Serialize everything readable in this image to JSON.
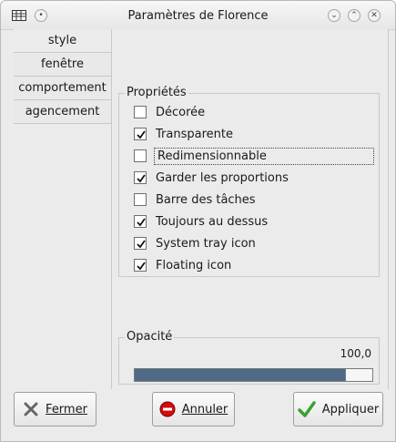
{
  "window": {
    "title": "Paramètres de Florence"
  },
  "tabs": [
    {
      "label": "style"
    },
    {
      "label": "fenêtre"
    },
    {
      "label": "comportement"
    },
    {
      "label": "agencement"
    }
  ],
  "properties": {
    "title": "Propriétés",
    "options": [
      {
        "label": "Décorée",
        "checked": false
      },
      {
        "label": "Transparente",
        "checked": true
      },
      {
        "label": "Redimensionnable",
        "checked": false
      },
      {
        "label": "Garder les proportions",
        "checked": true
      },
      {
        "label": "Barre des tâches",
        "checked": false
      },
      {
        "label": "Toujours au dessus",
        "checked": true
      },
      {
        "label": "System tray icon",
        "checked": true
      },
      {
        "label": "Floating icon",
        "checked": true
      }
    ]
  },
  "opacity": {
    "title": "Opacité",
    "value_text": "100,0",
    "fraction": 0.9
  },
  "buttons": {
    "close": "Fermer",
    "cancel": "Annuler",
    "apply": "Appliquer"
  },
  "colors": {
    "slider_fill": "#4f6a86",
    "cancel_red": "#d10d0d",
    "apply_green": "#3aa12f"
  }
}
